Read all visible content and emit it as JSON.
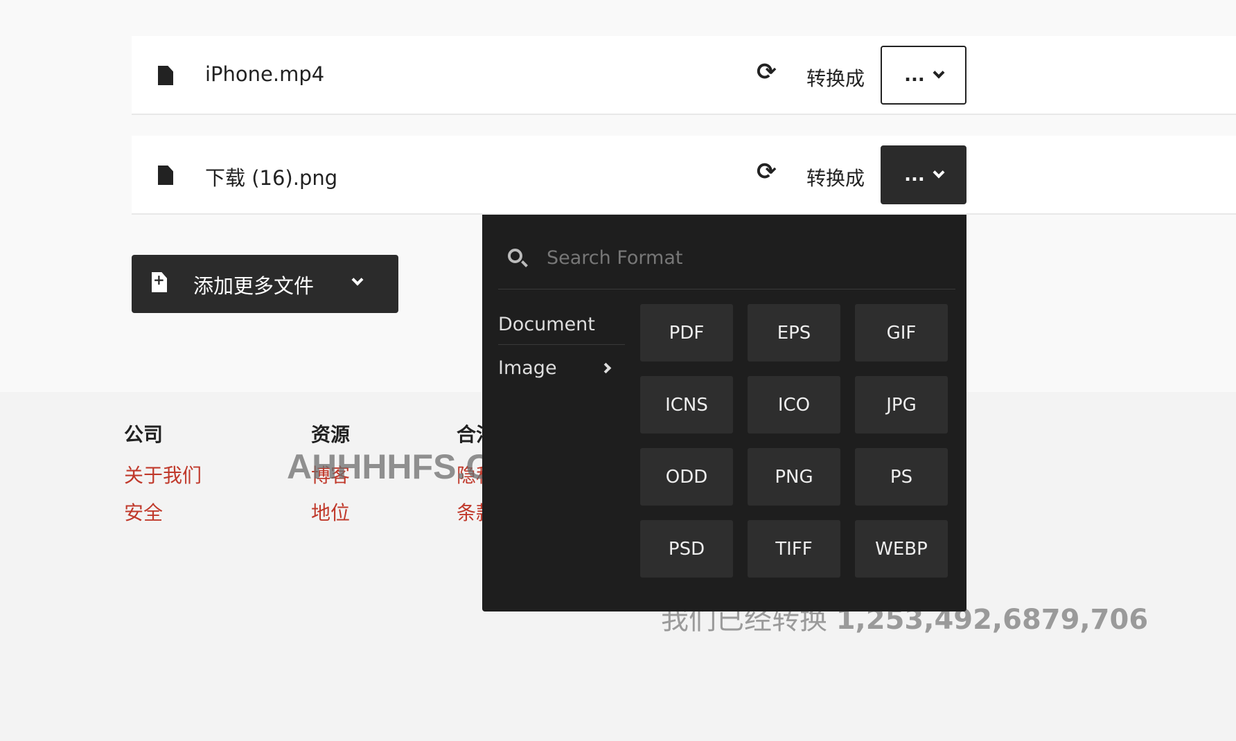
{
  "files": [
    {
      "name": "iPhone.mp4",
      "convert_label": "转换成",
      "selected": "...",
      "active": false
    },
    {
      "name": "下载 (16).png",
      "convert_label": "转换成",
      "selected": "...",
      "active": true
    }
  ],
  "add_button": {
    "label": "添加更多文件"
  },
  "format_dropdown": {
    "search_placeholder": "Search Format",
    "categories": [
      {
        "label": "Document"
      },
      {
        "label": "Image",
        "selected": true
      }
    ],
    "formats": [
      "PDF",
      "EPS",
      "GIF",
      "ICNS",
      "ICO",
      "JPG",
      "ODD",
      "PNG",
      "PS",
      "PSD",
      "TIFF",
      "WEBP"
    ]
  },
  "footer": {
    "columns": [
      {
        "title": "公司",
        "links": [
          "关于我们",
          "安全"
        ]
      },
      {
        "title": "资源",
        "links": [
          "博客",
          "地位"
        ]
      },
      {
        "title": "合法",
        "links": [
          "隐私",
          "条款"
        ]
      }
    ],
    "counter_label": "我们已经转换",
    "counter_value": "1,253,492,6879,706"
  },
  "watermark": "AHHHHFS.COM",
  "colors": {
    "link": "#c0392b",
    "panel": "#1e1e1e",
    "button_dark": "#2b2b2b"
  }
}
